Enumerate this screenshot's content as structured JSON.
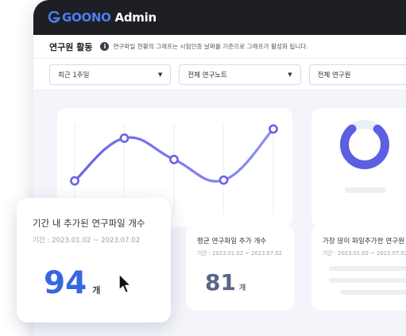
{
  "app": {
    "logo_brand": "GOONO",
    "logo_suffix": " Admin"
  },
  "header": {
    "title": "연구원 활동",
    "info_text": "연구파일 현황의 그래프는 시험인증 날짜를 기준으로 그래프가 활성화 됩니다."
  },
  "filters": [
    {
      "value": "최근 1주일"
    },
    {
      "value": "전체 연구노트"
    },
    {
      "value": "전체 연구원"
    }
  ],
  "chart_data": {
    "type": "line",
    "values": [
      17,
      73,
      45,
      18,
      85
    ],
    "ylim": [
      0,
      100
    ]
  },
  "cards": {
    "period_files": {
      "title": "기간 내 추가된 연구파일 개수",
      "period": "기간 : 2023.01.02 ~ 2023.07.02",
      "value": "94",
      "unit": "개"
    },
    "avg_files": {
      "title": "평균 연구파일 추가 개수",
      "period": "기간 : 2023.01.02 ~ 2023.07.02",
      "value": "81",
      "unit": "개"
    },
    "most_files": {
      "title": "가장 많이 파일추가한 연구원",
      "period": "기간 : 2023.01.02 ~ 2023.07.02"
    }
  },
  "donut": {
    "fill_fraction": 0.78,
    "color": "#5b5fe0"
  },
  "colors": {
    "accent": "#3568e0",
    "line_start": "#6a63e6",
    "line_end": "#7b87f5",
    "topbar": "#1d1f24"
  },
  "icons": [
    "goono-logo-icon",
    "info-icon",
    "chevron-down-icon",
    "mouse-cursor-icon"
  ]
}
